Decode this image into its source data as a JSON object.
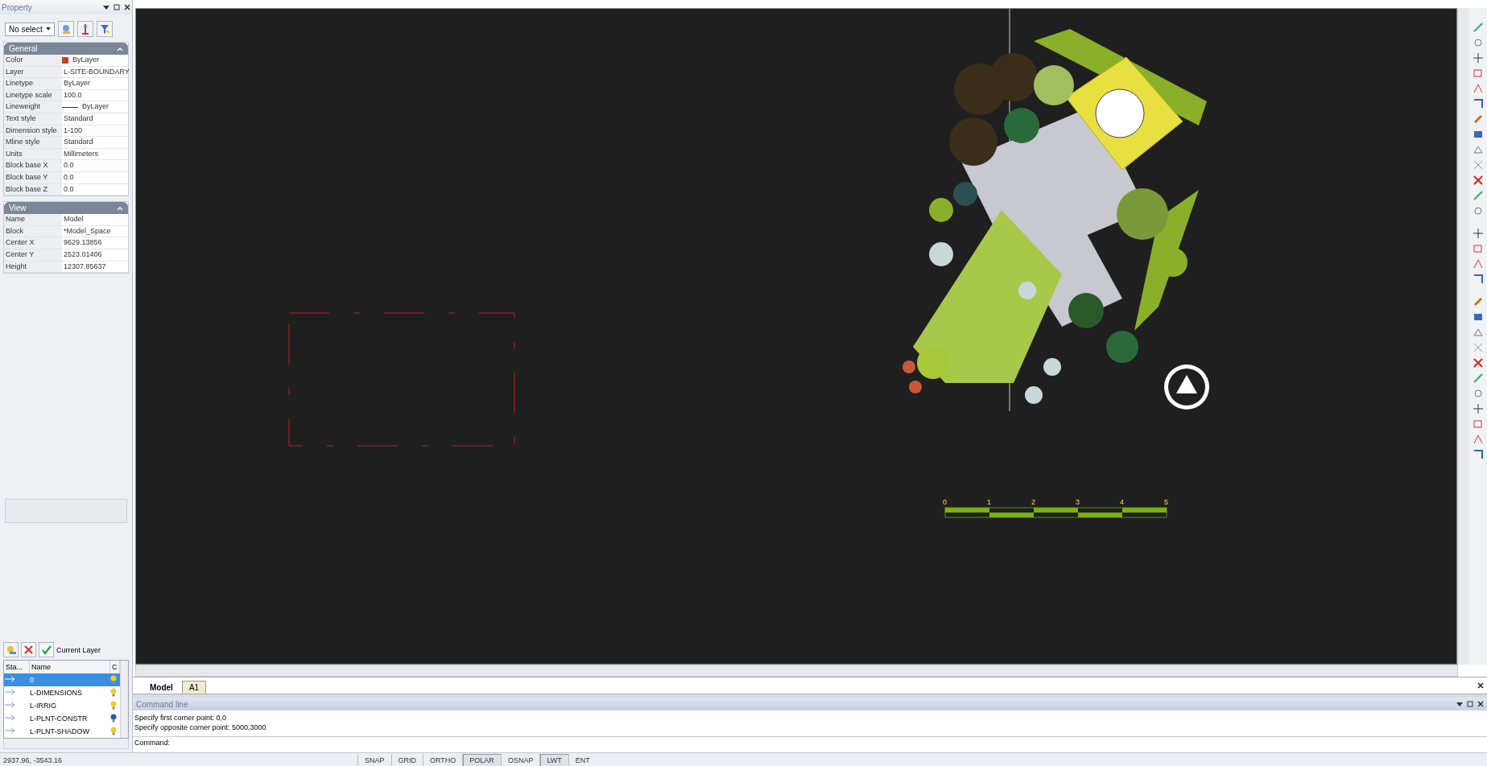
{
  "properties_panel": {
    "title": "Property",
    "selection": "No select",
    "sections": [
      {
        "title": "General",
        "rows": [
          {
            "kind": "color",
            "label": "Color",
            "value": "ByLayer",
            "color": "#c0462a"
          },
          {
            "kind": "text",
            "label": "Layer",
            "value": "L-SITE-BOUNDARY"
          },
          {
            "kind": "text",
            "label": "Linetype",
            "value": "ByLayer"
          },
          {
            "kind": "text",
            "label": "Linetype scale",
            "value": "100.0"
          },
          {
            "kind": "line",
            "label": "Lineweight",
            "value": "ByLayer"
          },
          {
            "kind": "text",
            "label": "Text style",
            "value": "Standard"
          },
          {
            "kind": "text",
            "label": "Dimension style",
            "value": "1-100"
          },
          {
            "kind": "text",
            "label": "Mline style",
            "value": "Standard"
          },
          {
            "kind": "text",
            "label": "Units",
            "value": "Millimeters"
          },
          {
            "kind": "text",
            "label": "Block base X",
            "value": "0.0"
          },
          {
            "kind": "text",
            "label": "Block base Y",
            "value": "0.0"
          },
          {
            "kind": "text",
            "label": "Block base Z",
            "value": "0.0"
          }
        ]
      },
      {
        "title": "View",
        "rows": [
          {
            "kind": "text",
            "label": "Name",
            "value": "Model"
          },
          {
            "kind": "text",
            "label": "Block",
            "value": "*Model_Space"
          },
          {
            "kind": "text",
            "label": "Center X",
            "value": "9629.13856"
          },
          {
            "kind": "text",
            "label": "Center Y",
            "value": "2523.01406"
          },
          {
            "kind": "text",
            "label": "Height",
            "value": "12307.85637"
          }
        ]
      }
    ]
  },
  "layers_panel": {
    "toolbar_label": "Current Layer",
    "columns": [
      "Sta...",
      "Name",
      "C"
    ],
    "rows": [
      {
        "name": "0",
        "selected": true,
        "on": true
      },
      {
        "name": "L-DIMENSIONS",
        "selected": false,
        "on": true
      },
      {
        "name": "L-IRRIG",
        "selected": false,
        "on": true
      },
      {
        "name": "L-PLNT-CONSTR",
        "selected": false,
        "on": false
      },
      {
        "name": "L-PLNT-SHADOW",
        "selected": false,
        "on": true
      }
    ]
  },
  "drawing": {
    "scale_labels": [
      "0",
      "1",
      "2",
      "3",
      "4",
      "5"
    ]
  },
  "layout_tabs": [
    {
      "label": "Model",
      "selected": true
    },
    {
      "label": "A1",
      "selected": false
    }
  ],
  "command_line": {
    "title": "Command line",
    "history": [
      "Specify first corner point: 0,0",
      "Specify opposite corner point: 5000,3000"
    ],
    "prompt": "Command:"
  },
  "status_bar": {
    "coordinates": "2937.96, -3543.16",
    "toggles": [
      {
        "label": "SNAP",
        "on": false
      },
      {
        "label": "GRID",
        "on": false
      },
      {
        "label": "ORTHO",
        "on": false
      },
      {
        "label": "POLAR",
        "on": true
      },
      {
        "label": "OSNAP",
        "on": false
      },
      {
        "label": "LWT",
        "on": true
      },
      {
        "label": "ENT",
        "on": false
      }
    ]
  }
}
